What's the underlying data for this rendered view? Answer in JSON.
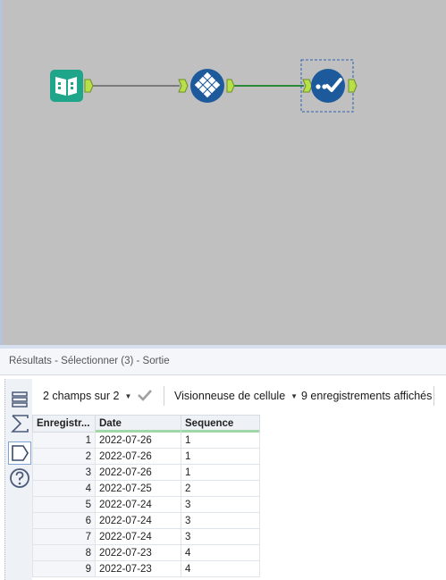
{
  "panel": {
    "title": "Résultats - Sélectionner (3) - Sortie"
  },
  "toolbar": {
    "fields_label": "2 champs sur 2",
    "viewer_label": "Visionneuse de cellule",
    "records_label": "9 enregistrements affichés"
  },
  "table": {
    "headers": [
      "Enregistr...",
      "Date",
      "Sequence"
    ],
    "rows": [
      {
        "rec": "1",
        "date": "2022-07-26",
        "seq": "1"
      },
      {
        "rec": "2",
        "date": "2022-07-26",
        "seq": "1"
      },
      {
        "rec": "3",
        "date": "2022-07-26",
        "seq": "1"
      },
      {
        "rec": "4",
        "date": "2022-07-25",
        "seq": "2"
      },
      {
        "rec": "5",
        "date": "2022-07-24",
        "seq": "3"
      },
      {
        "rec": "6",
        "date": "2022-07-24",
        "seq": "3"
      },
      {
        "rec": "7",
        "date": "2022-07-24",
        "seq": "3"
      },
      {
        "rec": "8",
        "date": "2022-07-23",
        "seq": "4"
      },
      {
        "rec": "9",
        "date": "2022-07-23",
        "seq": "4"
      }
    ]
  },
  "workflow": {
    "tools": [
      {
        "name": "input-data-tool",
        "icon": "book-icon",
        "color": "#1ea58a"
      },
      {
        "name": "multi-row-formula-tool",
        "icon": "diamond-grid-icon",
        "color": "#1d5a9c"
      },
      {
        "name": "select-tool",
        "icon": "check-icon",
        "color": "#1d5a9c"
      }
    ],
    "connection_colors": [
      "#7a7a7a",
      "#2a8a3a"
    ],
    "anchor_color": "#b7df4a"
  },
  "sidebar": {
    "icons": [
      "table-icon",
      "sigma-icon",
      "tag-icon",
      "help-icon"
    ]
  }
}
